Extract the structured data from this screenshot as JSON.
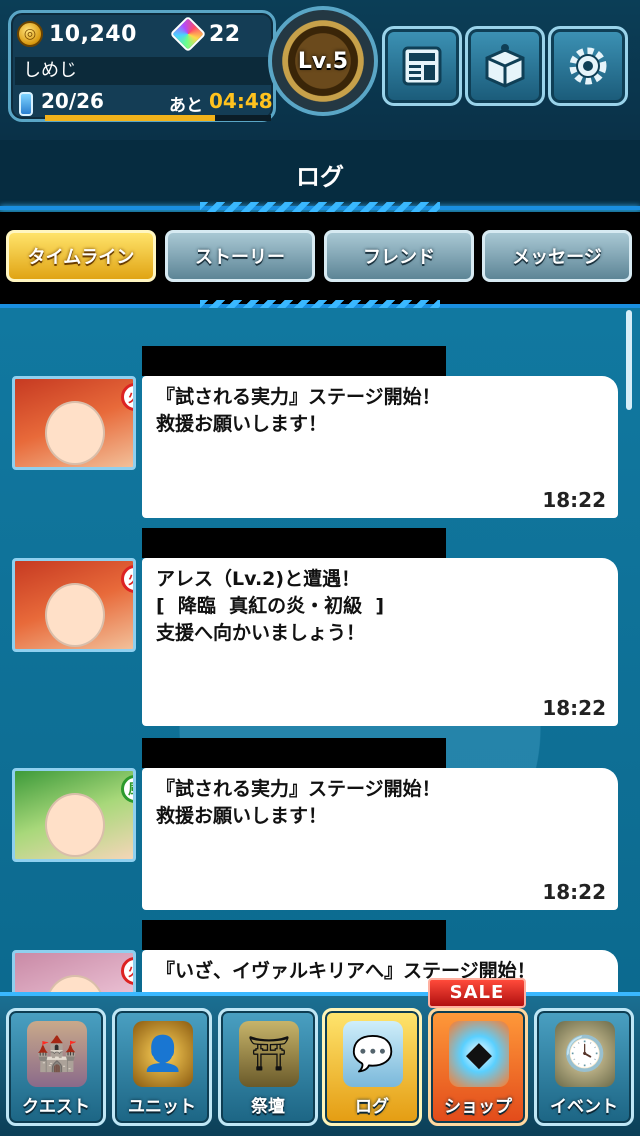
{
  "header": {
    "coins": "10,240",
    "gems": "22",
    "player_name": "しめじ",
    "stamina": "20/26",
    "stamina_label": "あと",
    "stamina_timer": "04:48",
    "stamina_fraction": 0.75,
    "level": "Lv.5",
    "buttons": [
      {
        "icon": "news-icon"
      },
      {
        "icon": "gift-box-icon"
      },
      {
        "icon": "gear-icon"
      }
    ]
  },
  "page_title": "ログ",
  "tabs": [
    {
      "label": "タイムライン",
      "active": true
    },
    {
      "label": "ストーリー",
      "active": false
    },
    {
      "label": "フレンド",
      "active": false
    },
    {
      "label": "メッセージ",
      "active": false
    }
  ],
  "log_entries": [
    {
      "text": "『試される実力』ステージ開始！\n救援お願いします！",
      "time": "18:22",
      "element": "fire"
    },
    {
      "text": "アレス（Lv.2)と遭遇！\n[  降臨  真紅の炎・初級  ]\n支援へ向かいましょう！",
      "time": "18:22",
      "element": "fire"
    },
    {
      "text": "『試される実力』ステージ開始！\n救援お願いします！",
      "time": "18:22",
      "element": "wind"
    },
    {
      "text": "『いざ、イヴァルキリアへ』ステージ開始！",
      "time": "",
      "element": "fire"
    }
  ],
  "nav": [
    {
      "label": "クエスト",
      "icon": "castle-icon"
    },
    {
      "label": "ユニット",
      "icon": "unit-silhouette-icon"
    },
    {
      "label": "祭壇",
      "icon": "altar-icon"
    },
    {
      "label": "ログ",
      "icon": "chat-log-icon",
      "active": true
    },
    {
      "label": "ショップ",
      "icon": "shop-crystal-icon",
      "sale": "SALE"
    },
    {
      "label": "イベント",
      "icon": "clock-event-icon"
    }
  ],
  "colors": {
    "accent_blue": "#1a8fe0",
    "tab_active": "#e0a414",
    "timer_yellow": "#ffc21e",
    "sale_red": "#d52020"
  }
}
